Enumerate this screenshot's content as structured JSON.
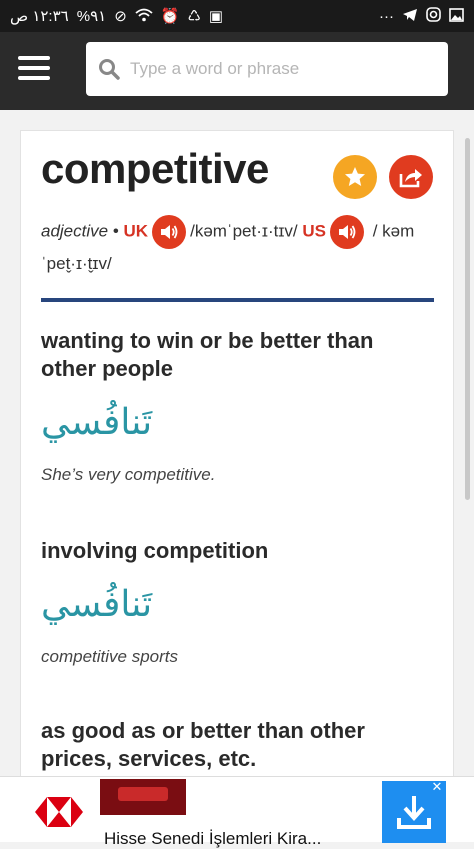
{
  "status_bar": {
    "time": "١٢:٣٦ ص",
    "battery": "%٩١",
    "dots": "···"
  },
  "header": {
    "search_placeholder": "Type a word or phrase"
  },
  "entry": {
    "headword": "competitive",
    "part_of_speech": "adjective",
    "bullet": "•",
    "uk_label": "UK",
    "uk_ipa": "/kəmˈpet·ɪ·tɪv/",
    "us_label": "US",
    "us_ipa": "/",
    "us_ipa_cont": "kəmˈpet̬·ɪ·t̬ɪv/"
  },
  "senses": [
    {
      "definition": "wanting to win or be better than other people",
      "translation": "تَنافُسي",
      "example": "She’s very competitive."
    },
    {
      "definition": "involving competition",
      "translation": "تَنافُسي",
      "example": "competitive sports"
    },
    {
      "definition": "as good as or better than other prices, services, etc."
    }
  ],
  "ad": {
    "text": "Hisse Senedi İşlemleri Kira..."
  },
  "colors": {
    "accent_red": "#e03b1f",
    "star_yellow": "#f5a623",
    "rule_blue": "#28467d",
    "arabic_teal": "#2a95a4"
  }
}
